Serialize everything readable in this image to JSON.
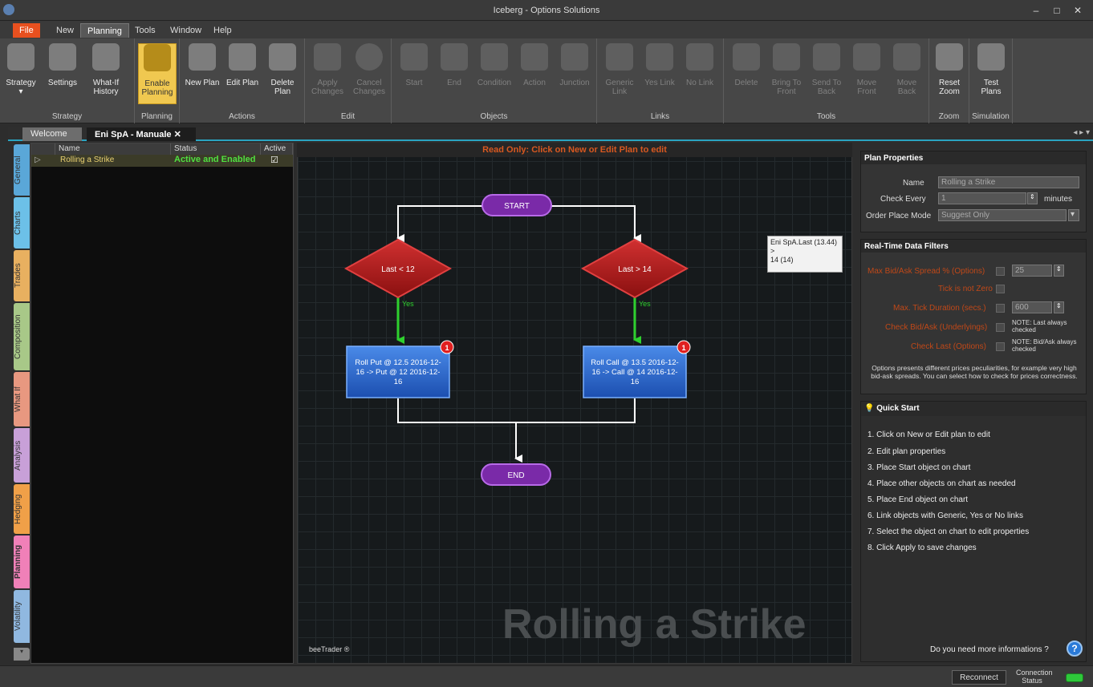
{
  "window": {
    "title": "Iceberg - Options Solutions",
    "controls": [
      "–",
      "□",
      "✕"
    ]
  },
  "menu": [
    "File",
    "New",
    "Planning",
    "Tools",
    "Window",
    "Help"
  ],
  "ribbon": {
    "groups": [
      {
        "label": "Strategy",
        "buttons": [
          {
            "label": "Strategy\n▾"
          },
          {
            "label": "Settings"
          },
          {
            "label": "What-If\nHistory"
          }
        ]
      },
      {
        "label": "Planning",
        "buttons": [
          {
            "label": "Enable\nPlanning"
          }
        ]
      },
      {
        "label": "Actions",
        "buttons": [
          {
            "label": "New Plan"
          },
          {
            "label": "Edit Plan"
          },
          {
            "label": "Delete\nPlan"
          }
        ]
      },
      {
        "label": "Edit",
        "buttons": [
          {
            "label": "Apply\nChanges"
          },
          {
            "label": "Cancel\nChanges"
          }
        ]
      },
      {
        "label": "Objects",
        "buttons": [
          {
            "label": "Start"
          },
          {
            "label": "End"
          },
          {
            "label": "Condition"
          },
          {
            "label": "Action"
          },
          {
            "label": "Junction"
          }
        ]
      },
      {
        "label": "Links",
        "buttons": [
          {
            "label": "Generic\nLink"
          },
          {
            "label": "Yes Link"
          },
          {
            "label": "No Link"
          }
        ]
      },
      {
        "label": "Tools",
        "buttons": [
          {
            "label": "Delete"
          },
          {
            "label": "Bring To\nFront"
          },
          {
            "label": "Send To\nBack"
          },
          {
            "label": "Move\nFront"
          },
          {
            "label": "Move\nBack"
          }
        ]
      },
      {
        "label": "Zoom",
        "buttons": [
          {
            "label": "Reset\nZoom"
          }
        ]
      },
      {
        "label": "Simulation",
        "buttons": [
          {
            "label": "Test\nPlans"
          }
        ]
      }
    ]
  },
  "tabs": {
    "welcome": "Welcome",
    "active": "Eni SpA - Manuale ✕",
    "nav": "◂ ▸ ▾"
  },
  "side_tabs": [
    "General",
    "Charts",
    "Trades",
    "Composition",
    "What If",
    "Analysis",
    "Hedging",
    "Planning",
    "Volatility"
  ],
  "grid": {
    "headers": [
      "Name",
      "Status",
      "Active"
    ],
    "rows": [
      {
        "expander": "▷",
        "name": "Rolling a Strike",
        "status": "Active and Enabled",
        "active": "☑"
      }
    ]
  },
  "canvas": {
    "header": "Read Only: Click on New or Edit Plan to edit",
    "watermark": "Rolling a Strike",
    "brand": "beeTrader ®",
    "tooltip": {
      "line1": "Eni SpA.Last (13.44)",
      "line2": ">",
      "line3": "14 (14)"
    },
    "nodes": {
      "start": "START",
      "end": "END",
      "cond_left": "Last < 12",
      "cond_right": "Last > 14",
      "action_left": [
        "Roll Put @ 12.5 2016-12-",
        "16 -> Put @ 12 2016-12-",
        "16"
      ],
      "action_right": [
        "Roll Call @ 13.5 2016-12-",
        "16 -> Call @ 14 2016-12-",
        "16"
      ],
      "yes": "Yes",
      "badge": "1"
    }
  },
  "plan_properties": {
    "title": "Plan Properties",
    "name_label": "Name",
    "name_value": "Rolling a Strike",
    "check_label": "Check Every",
    "check_value": "1",
    "check_unit": "minutes",
    "mode_label": "Order Place Mode",
    "mode_value": "Suggest Only"
  },
  "filters": {
    "title": "Real-Time Data Filters",
    "max_spread_label": "Max Bid/Ask Spread % (Options)",
    "max_spread_value": "25",
    "tick_not_zero": "Tick is not Zero",
    "max_tick_label": "Max. Tick Duration (secs.)",
    "max_tick_value": "600",
    "check_bidask": "Check Bid/Ask (Underlyings)",
    "check_bidask_note": "NOTE: Last always checked",
    "check_last": "Check Last (Options)",
    "check_last_note": "NOTE: Bid/Ask always checked",
    "description": "Options presents different prices peculiarities, for example very high bid-ask spreads. You can select how to check for prices correctness."
  },
  "quick_start": {
    "title": "Quick Start",
    "steps": [
      "1. Click on New or Edit plan to edit",
      "2. Edit plan properties",
      "3. Place Start object on chart",
      "4. Place other objects on chart as needed",
      "5. Place End object on chart",
      "6. Link objects with Generic, Yes or No links",
      "7. Select the object on chart to edit properties",
      "8. Click Apply to save changes"
    ],
    "help_text": "Do you need more informations ?"
  },
  "status": {
    "reconnect": "Reconnect",
    "connection": "Connection Status"
  },
  "colors": {
    "accent": "#2aa3c0",
    "file_menu": "#e8501f",
    "condition": "#b01c1c",
    "action": "#2a6fd0",
    "terminal": "#7a2aa8",
    "yes_link": "#2ed02e",
    "led": "#2ec83a"
  }
}
